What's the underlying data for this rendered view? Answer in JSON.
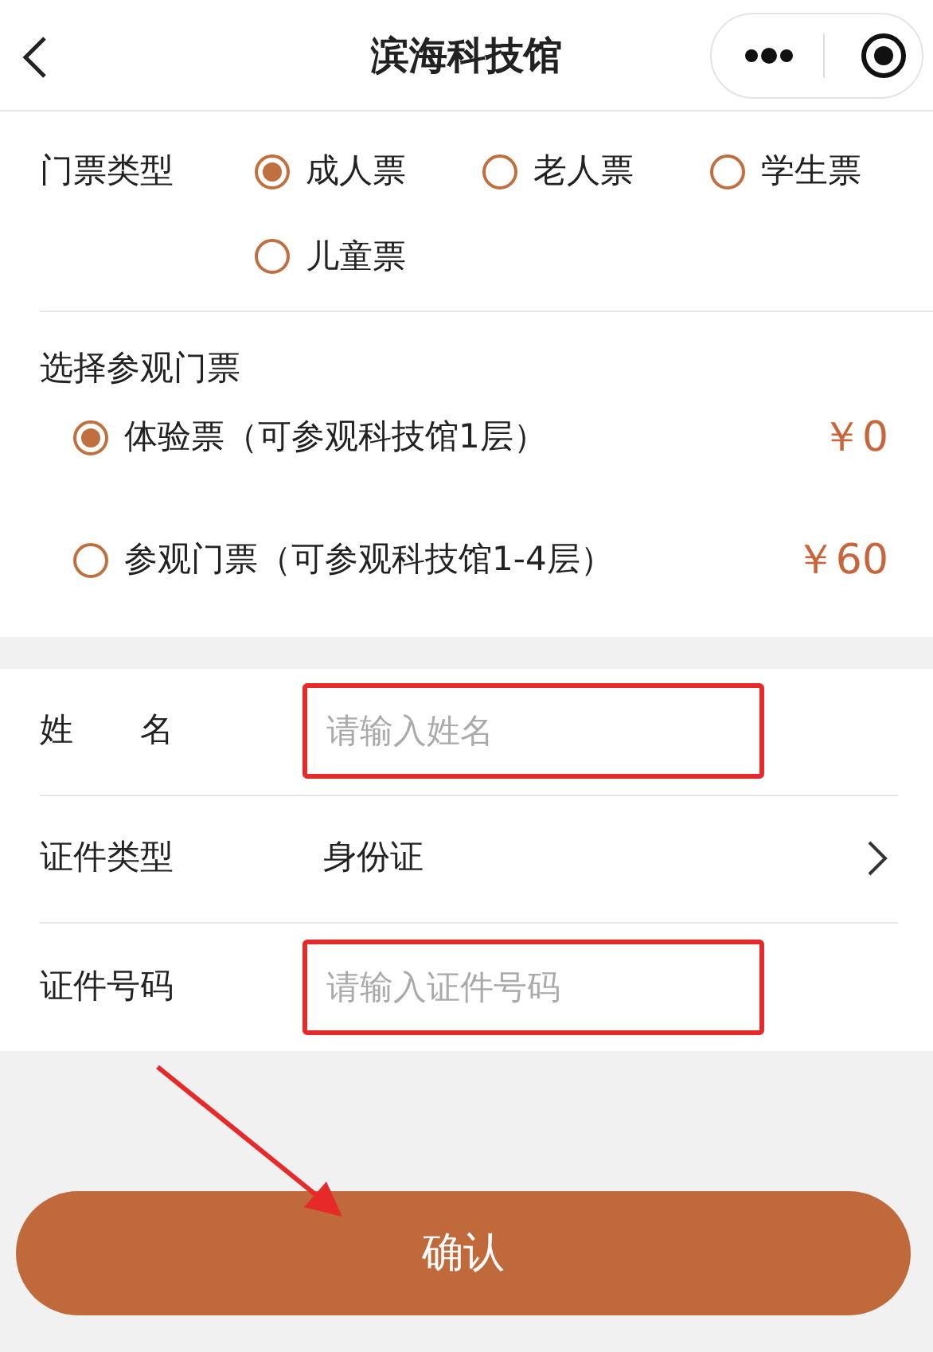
{
  "header": {
    "title": "滨海科技馆"
  },
  "ticket_type": {
    "label": "门票类型",
    "options": [
      {
        "label": "成人票",
        "selected": true
      },
      {
        "label": "老人票",
        "selected": false
      },
      {
        "label": "学生票",
        "selected": false
      },
      {
        "label": "儿童票",
        "selected": false
      }
    ]
  },
  "visit_ticket": {
    "label": "选择参观门票",
    "options": [
      {
        "label": "体验票（可参观科技馆1层）",
        "price": "￥0",
        "selected": true
      },
      {
        "label": "参观门票（可参观科技馆1-4层）",
        "price": "￥60",
        "selected": false
      }
    ]
  },
  "form": [
    {
      "kind": "input",
      "label": "姓　　名",
      "placeholder": "请输入姓名",
      "highlighted": true
    },
    {
      "kind": "select",
      "label": "证件类型",
      "value": "身份证"
    },
    {
      "kind": "input",
      "label": "证件号码",
      "placeholder": "请输入证件号码",
      "highlighted": true
    }
  ],
  "confirm_button": "确认"
}
